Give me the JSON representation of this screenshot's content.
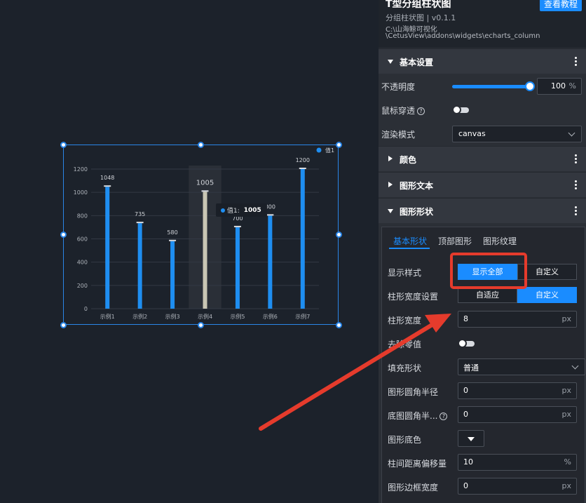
{
  "header": {
    "title": "T型分组柱状图",
    "tutorial_button": "查看教程",
    "subtitle": "分组柱状图 | v0.1.1",
    "path_line1": "C:\\山海鲸可视化",
    "path_line2": "\\CetusView\\addons\\widgets\\echarts_column"
  },
  "sections": {
    "basic": "基本设置",
    "color": "颜色",
    "text": "图形文本",
    "shape": "图形形状"
  },
  "basic": {
    "opacity_label": "不透明度",
    "opacity_value": "100",
    "opacity_unit": "%",
    "opacity_level": 1.0,
    "mouse_through_label": "鼠标穿透",
    "mouse_through_on": false,
    "render_label": "渲染模式",
    "render_value": "canvas"
  },
  "shape": {
    "tabs": [
      "基本形状",
      "顶部图形",
      "图形纹理"
    ],
    "display_style_label": "显示样式",
    "display_style_options": [
      "显示全部",
      "自定义"
    ],
    "width_setting_label": "柱形宽度设置",
    "width_setting_options": [
      "自适应",
      "自定义"
    ],
    "bar_width_label": "柱形宽度",
    "bar_width_value": "8",
    "bar_width_unit": "px",
    "remove_zero_label": "去除零值",
    "fill_shape_label": "填充形状",
    "fill_shape_value": "普通",
    "radius_label": "图形圆角半径",
    "radius_value": "0",
    "radius_unit": "px",
    "base_radius_label": "底图圆角半...",
    "base_radius_value": "0",
    "base_radius_unit": "px",
    "base_color_label": "图形底色",
    "gap_offset_label": "柱间距离偏移量",
    "gap_offset_value": "10",
    "gap_offset_unit": "%",
    "border_width_label": "图形边框宽度",
    "border_width_value": "0",
    "border_width_unit": "px"
  },
  "tooltip": {
    "series": "值1:",
    "value": "1005"
  },
  "colors": {
    "bar": "#1e8ef1",
    "highlight_bar": "#c9c6b4",
    "accent": "#1a8cff",
    "annotation": "#e53b2c"
  },
  "chart_data": {
    "type": "bar",
    "categories": [
      "示例1",
      "示例2",
      "示例3",
      "示例4",
      "示例5",
      "示例6",
      "示例7"
    ],
    "series": [
      {
        "name": "值1",
        "values": [
          1048,
          735,
          580,
          1005,
          700,
          800,
          1200
        ]
      }
    ],
    "data_labels": [
      "1048",
      "735",
      "580",
      "1005",
      "700",
      "800",
      "1200"
    ],
    "yticks": [
      "0",
      "200",
      "400",
      "600",
      "800",
      "1000",
      "1200"
    ],
    "ylim": [
      0,
      1200
    ],
    "highlighted_category": "示例4",
    "legend": "top-right",
    "grid": true
  }
}
